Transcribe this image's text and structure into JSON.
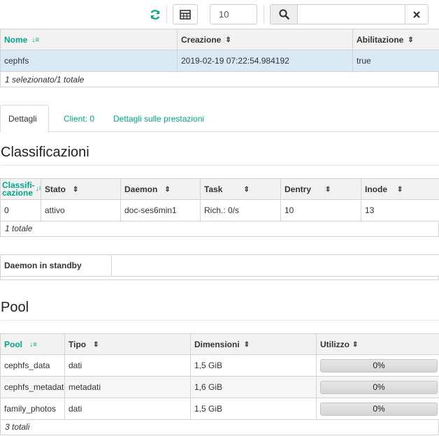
{
  "toolbar": {
    "refresh_icon": "refresh-icon",
    "columns_icon": "table-columns-icon",
    "page_size": "10",
    "search_icon": "search-icon",
    "search_value": "",
    "clear_icon": "close-icon"
  },
  "fs_table": {
    "columns": [
      "Nome",
      "Creazione",
      "Abilitazione"
    ],
    "rows": [
      [
        "cephfs",
        "2019-02-19 07:22:54.984192",
        "true"
      ]
    ],
    "footer": "1 selezionato/1 totale"
  },
  "tabs": [
    "Dettagli",
    "Client: 0",
    "Dettagli sulle prestazioni"
  ],
  "ranks_section": {
    "title": "Classificazioni",
    "columns": [
      "Classificazione",
      "Stato",
      "Daemon",
      "Task",
      "Dentry",
      "Inode"
    ],
    "first_col_line1": "Classifi-",
    "first_col_line2": "cazione",
    "rows": [
      [
        "0",
        "attivo",
        "doc-ses6min1",
        "Rich.: 0/s",
        "10",
        "13"
      ]
    ],
    "footer": "1 totale"
  },
  "standby": {
    "label": "Daemon in standby",
    "value": ""
  },
  "pool_section": {
    "title": "Pool",
    "columns": [
      "Pool",
      "Tipo",
      "Dimensioni",
      "Utilizzo"
    ],
    "rows": [
      [
        "cephfs_data",
        "dati",
        "1,5 GiB",
        "0%"
      ],
      [
        "cephfs_metadata",
        "metadati",
        "1,6 GiB",
        "0%"
      ],
      [
        "family_photos",
        "dati",
        "1,5 GiB",
        "0%"
      ]
    ],
    "footer": "3 totali"
  },
  "colors": {
    "accent": "#00a68a",
    "selected_row": "#d9eaf5",
    "header_bg": "#f2f2f2"
  }
}
